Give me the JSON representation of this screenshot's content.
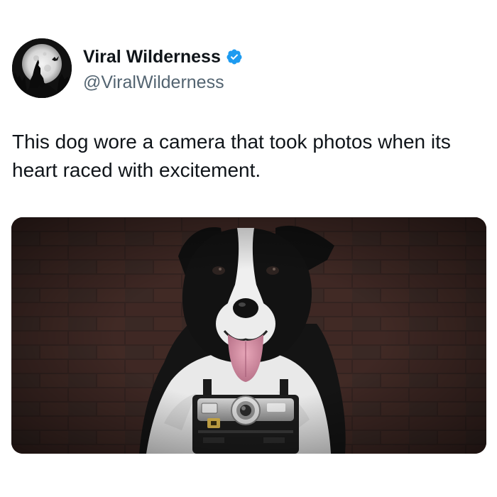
{
  "post": {
    "author": {
      "display_name": "Viral Wilderness",
      "handle": "@ViralWilderness",
      "verified": true,
      "avatar_icon": "howling-wolf-moon-avatar",
      "verified_icon": "verified-badge-icon",
      "verified_color": "#1d9bf0"
    },
    "text": "This dog wore a camera that took photos when its heart raced with excitement.",
    "media": {
      "type": "image",
      "subject": "dog-with-camera-photo"
    }
  },
  "colors": {
    "text_primary": "#0f1419",
    "text_secondary": "#536471",
    "background": "#ffffff"
  }
}
